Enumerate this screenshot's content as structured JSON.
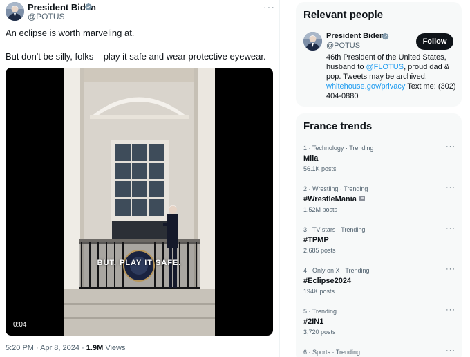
{
  "tweet": {
    "author_name": "President Biden",
    "author_handle": "@POTUS",
    "more_label": "···",
    "text_line1": "An eclipse is worth marveling at.",
    "text_line2": "But don't be silly, folks – play it safe and wear protective eyewear.",
    "video": {
      "caption": "BUT, PLAY IT SAFE.",
      "duration": "0:04"
    },
    "time": "5:20 PM · Apr 8, 2024 · ",
    "views_count": "1.9M",
    "views_label": " Views"
  },
  "relevant_people": {
    "title": "Relevant people",
    "person": {
      "name": "President Biden",
      "handle": "@POTUS",
      "follow_label": "Follow",
      "bio_part1": "46th President of the United States, husband to ",
      "bio_link1": "@FLOTUS",
      "bio_part2": ", proud dad & pop. Tweets may be archived: ",
      "bio_link2": "whitehouse.gov/privacy",
      "bio_part3": " Text me: (302) 404-0880"
    }
  },
  "trends": {
    "title": "France trends",
    "items": [
      {
        "context": "1 · Technology · Trending",
        "name": "Mila",
        "posts": "56.1K posts",
        "more": "···"
      },
      {
        "context": "2 · Wrestling · Trending",
        "name": "#WrestleMania",
        "posts": "1.52M posts",
        "more": "···"
      },
      {
        "context": "3 · TV stars · Trending",
        "name": "#TPMP",
        "posts": "2,685 posts",
        "more": "···"
      },
      {
        "context": "4 · Only on X · Trending",
        "name": "#Eclipse2024",
        "posts": "194K posts",
        "more": "···"
      },
      {
        "context": "5 · Trending",
        "name": "#2IN1",
        "posts": "3,720 posts",
        "more": "···"
      },
      {
        "context": "6 · Sports · Trending",
        "name": "",
        "posts": "",
        "more": "···"
      }
    ]
  },
  "colors": {
    "accent": "#1d9bf0",
    "text": "#0f1419",
    "secondary": "#536471",
    "card_bg": "#f7f9f9"
  },
  "icons": [
    "verified-badge-icon",
    "more-icon"
  ]
}
